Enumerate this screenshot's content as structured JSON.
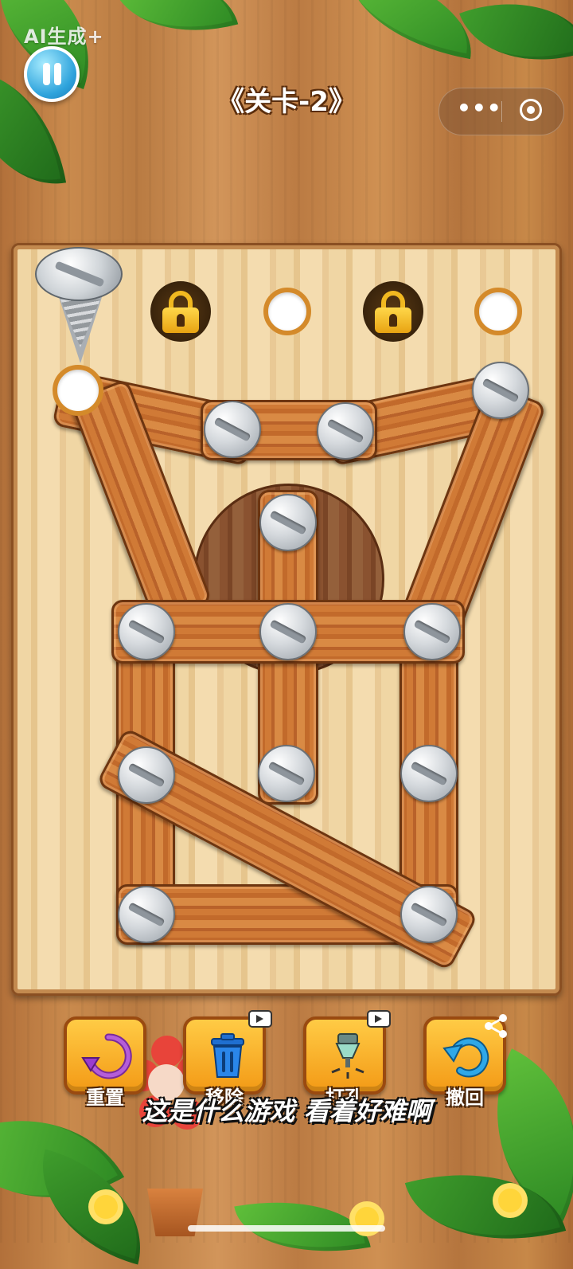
{
  "watermark": "AI生成+",
  "header": {
    "level_title": "《关卡-2》"
  },
  "toolbar": {
    "buttons": [
      {
        "label": "重置",
        "icon": "reset-arrow-icon",
        "ad": false
      },
      {
        "label": "移除",
        "icon": "trash-icon",
        "ad": true
      },
      {
        "label": "打孔",
        "icon": "drill-icon",
        "ad": true
      },
      {
        "label": "撤回",
        "icon": "undo-icon",
        "ad": false,
        "share": true
      }
    ]
  },
  "subtitle": "这是什么游戏 看着好难啊",
  "board": {
    "top_slots": [
      "empty",
      "locked",
      "empty",
      "locked",
      "empty"
    ]
  },
  "colors": {
    "hole_ring": "#d48a2a",
    "plank": "#c9742f",
    "button": "#f7b22c",
    "lock": "#f1b920"
  }
}
